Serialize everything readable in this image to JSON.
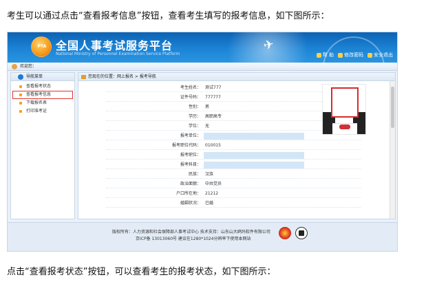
{
  "document": {
    "intro_text": "考生可以通过点击“查看报考信息”按钮，查看考生填写的报考信息，如下图所示：",
    "outro_text": "点击“查看报考状态”按钮，可以查看考生的报考状态，如下图所示："
  },
  "header": {
    "logo_text": "PTA",
    "title": "全国人事考试服务平台",
    "subtitle": "National Ministry of Personnel Examination Service Platform",
    "links": [
      {
        "label": "帮 助",
        "icon": "help-icon"
      },
      {
        "label": "修改密码",
        "icon": "key-icon"
      },
      {
        "label": "安全退出",
        "icon": "logout-icon"
      }
    ]
  },
  "welcome_bar": {
    "text": "欢迎您："
  },
  "sidebar": {
    "header": "导航菜单",
    "items": [
      {
        "label": "查看报考状态",
        "active": false
      },
      {
        "label": "查看报考信息",
        "active": true
      },
      {
        "label": "下载报名表",
        "active": false
      },
      {
        "label": "打印准考证",
        "active": false
      }
    ]
  },
  "breadcrumb": {
    "text": "您现在的位置：网上报名 > 报考导航"
  },
  "form": {
    "rows": [
      {
        "label": "考生姓名：",
        "value": "测试777",
        "highlight": false
      },
      {
        "label": "证件号码：",
        "value": "777777",
        "highlight": false
      },
      {
        "label": "性别：",
        "value": "男",
        "highlight": false
      },
      {
        "label": "学历：",
        "value": "高职高专",
        "highlight": false
      },
      {
        "label": "学位：",
        "value": "无",
        "highlight": false
      },
      {
        "label": "报考单位：",
        "value": "",
        "highlight": true
      },
      {
        "label": "报考职位代码：",
        "value": "010015",
        "highlight": false
      },
      {
        "label": "报考职位：",
        "value": "",
        "highlight": true
      },
      {
        "label": "报考科目：",
        "value": "",
        "highlight": true
      },
      {
        "label": "民族：",
        "value": "汉族",
        "highlight": false
      },
      {
        "label": "政治面貌：",
        "value": "中共党员",
        "highlight": false
      },
      {
        "label": "户口所在地：",
        "value": "21212",
        "highlight": false
      },
      {
        "label": "婚姻状况：",
        "value": "已婚",
        "highlight": false
      }
    ]
  },
  "footer": {
    "line1": "版权所有：人力资源和社会保障部人事考试中心  技术支持：山东山大鸥玛软件有限公司",
    "line2": "京ICP备 13013060号  建议在1280*1024分辨率下使用本网站"
  },
  "colors": {
    "banner": "#1c84d6",
    "highlight_field": "#d3e6f8",
    "active_outline": "#e0332e",
    "bullet": "#f4a11a"
  }
}
